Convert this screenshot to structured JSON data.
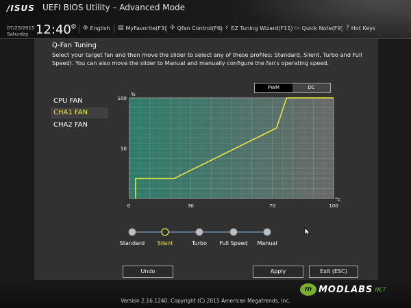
{
  "header": {
    "logo": "/ISUS",
    "title": "UEFI BIOS Utility – Advanced Mode",
    "date": "07/25/2015",
    "day": "Saturday",
    "time": "12:40",
    "items": [
      {
        "icon": "globe-icon",
        "label": "English"
      },
      {
        "icon": "favorite-icon",
        "label": "MyFavorite(F3)"
      },
      {
        "icon": "fan-icon",
        "label": "Qfan Control(F6)"
      },
      {
        "icon": "wand-icon",
        "label": "EZ Tuning Wizard(F11)"
      },
      {
        "icon": "note-icon",
        "label": "Quick Note(F9)"
      },
      {
        "icon": "help-icon",
        "label": "Hot Keys"
      }
    ]
  },
  "section": {
    "title": "Q-Fan Tuning",
    "description": "Select your target fan and then move the slider to select any of these profiles: Standard, Silent, Turbo and Full Speed). You can also move the slider to Manual and manually configure the fan's operating speed."
  },
  "fans": [
    "CPU FAN",
    "CHA1 FAN",
    "CHA2 FAN"
  ],
  "selected_fan": "CHA1 FAN",
  "mode_toggle": {
    "options": [
      "PWM",
      "DC"
    ],
    "selected": "DC"
  },
  "chart_data": {
    "type": "line",
    "y_unit": "%",
    "x_unit": "°C",
    "xlim": [
      0,
      100
    ],
    "ylim": [
      0,
      100
    ],
    "x_ticks": [
      0,
      30,
      70,
      100
    ],
    "y_ticks": [
      50,
      100
    ],
    "grid": true,
    "points": [
      [
        3,
        0
      ],
      [
        3,
        20
      ],
      [
        22,
        20
      ],
      [
        72,
        70
      ],
      [
        77,
        100
      ],
      [
        100,
        100
      ]
    ]
  },
  "profiles": [
    "Standard",
    "Silent",
    "Turbo",
    "Full Speed",
    "Manual"
  ],
  "selected_profile": "Silent",
  "buttons": {
    "undo": "Undo",
    "apply": "Apply",
    "exit": "Exit (ESC)"
  },
  "footer": {
    "version": "Version 2.16.1240. Copyright (C) 2015 American Megatrends, Inc."
  },
  "watermark": {
    "badge": "m",
    "text": "MODLABS",
    "sub": "NET"
  },
  "colors": {
    "accent": "#f2ea3c",
    "chart_left": "#2f7c6a",
    "chart_right": "#6a6a6a",
    "background": "#313131"
  }
}
